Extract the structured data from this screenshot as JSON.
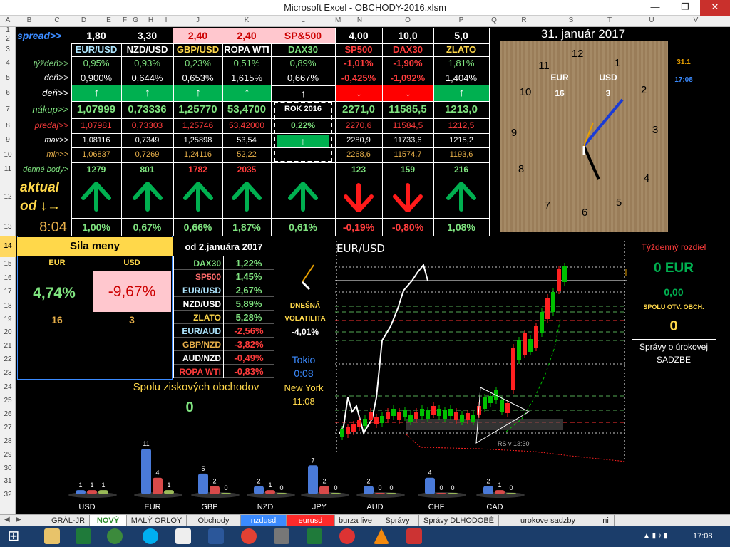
{
  "window": {
    "title": "Microsoft Excel - OBCHODY-2016.xlsm",
    "min": "—",
    "max": "❐",
    "close": "✕"
  },
  "columns": [
    "A",
    "B",
    "C",
    "D",
    "E",
    "F",
    "G",
    "H",
    "I",
    "J",
    "K",
    "L",
    "M",
    "N",
    "O",
    "P",
    "Q",
    "R",
    "S",
    "T",
    "U",
    "V"
  ],
  "rows": [
    "1",
    "2",
    "3",
    "4",
    "5",
    "6",
    "7",
    "8",
    "9",
    "10",
    "11",
    "12",
    "13",
    "14",
    "15",
    "16",
    "17",
    "18",
    "19",
    "20",
    "21",
    "22",
    "23",
    "24",
    "25",
    "26",
    "27",
    "28",
    "29",
    "30",
    "31",
    "32"
  ],
  "selected_row": "14",
  "header": {
    "spread_label": "spread>>",
    "spreads": [
      "1,80",
      "3,30",
      "2,40",
      "2,40"
    ],
    "sp500_label": "SP&500",
    "spreads2": [
      "4,00",
      "10,0",
      "5,0"
    ],
    "date": "31. január 2017"
  },
  "instruments": [
    "EUR/USD",
    "NZD/USD",
    "GBP/USD",
    "ROPA WTI",
    "DAX30",
    "SP500",
    "DAX30",
    "ZLATO"
  ],
  "rowlabels": {
    "week": "týždeň>>",
    "day": "deň>>",
    "day2": "deň>>",
    "buy": "nákup>>",
    "sell": "predaj>>",
    "max": "max>>",
    "min": "min>>",
    "points": "denné body>"
  },
  "week": [
    "0,95%",
    "0,93%",
    "0,23%",
    "0,51%",
    "0,89%",
    "-1,01%",
    "-1,90%",
    "1,81%"
  ],
  "day": [
    "0,900%",
    "0,644%",
    "0,653%",
    "1,615%",
    "0,667%",
    "-0,425%",
    "-1,092%",
    "1,404%"
  ],
  "arrow_up": "↑",
  "arrow_down": "↓",
  "buy": [
    "1,07999",
    "0,73336",
    "1,25770",
    "53,4700",
    "2271,0",
    "11585,5",
    "1213,0"
  ],
  "rok": "ROK 2016",
  "rok_val": "0,22%",
  "sell": [
    "1,07981",
    "0,73303",
    "1,25746",
    "53,42000",
    "2270,6",
    "11584,5",
    "1212,5"
  ],
  "max": [
    "1,08116",
    "0,7349",
    "1,25898",
    "53,54",
    "2280,9",
    "11733,6",
    "1215,2"
  ],
  "min": [
    "1,06837",
    "0,7269",
    "1,24116",
    "52,22",
    "2268,6",
    "11574,7",
    "1193,6"
  ],
  "points": [
    "1279",
    "801",
    "1782",
    "2035",
    "123",
    "159",
    "216"
  ],
  "actual_label": "aktual",
  "od_label": "od ↓→",
  "time": "8:04",
  "actual_pct": [
    "1,00%",
    "0,67%",
    "0,66%",
    "1,87%",
    "0,61%",
    "-0,19%",
    "-0,80%",
    "1,08%"
  ],
  "clock": {
    "numbers": [
      "12",
      "1",
      "2",
      "3",
      "4",
      "5",
      "6",
      "7",
      "8",
      "9",
      "10",
      "11"
    ],
    "eur": "EUR",
    "usd": "USD",
    "eur_v": "16",
    "usd_v": "3",
    "side1": "31.1",
    "side2": "17:08"
  },
  "strength": {
    "title": "Sila meny",
    "c1": "EUR",
    "c2": "USD",
    "v1": "4,74%",
    "v2": "-9,67%",
    "n1": "16",
    "n2": "3"
  },
  "perf": {
    "title": "od 2.januára 2017",
    "names": [
      "DAX30",
      "SP500",
      "EUR/USD",
      "NZD/USD",
      "ZLATO",
      "EUR/AUD",
      "GBP/NZD",
      "AUD/NZD",
      "ROPA WTI"
    ],
    "values": [
      "1,22%",
      "1,45%",
      "2,67%",
      "5,89%",
      "5,28%",
      "-2,56%",
      "-3,82%",
      "-0,49%",
      "-0,83%"
    ]
  },
  "vol": {
    "l1": "DNEŠNÁ",
    "l2": "VOLATILITA",
    "v": "-4,01%",
    "tokio": "Tokio",
    "tokio_t": "0:08",
    "ny": "New York",
    "ny_t": "11:08"
  },
  "profits": {
    "label": "Spolu ziskových obchodov",
    "v": "0"
  },
  "chart": {
    "title": "EUR/USD",
    "rs": "RS v 13:30"
  },
  "right": {
    "week_diff": "Týždenný rozdiel",
    "eur": "0 EUR",
    "zero": "0,00",
    "open": "SPOLU OTV. OBCH.",
    "open_v": "0",
    "news": "Správy o úrokovej",
    "rates": "SADZBE"
  },
  "currency_chart": {
    "type": "bar",
    "categories": [
      "USD",
      "EUR",
      "GBP",
      "NZD",
      "JPY",
      "AUD",
      "CHF",
      "CAD"
    ],
    "series": [
      {
        "values": [
          1,
          11,
          5,
          2,
          7,
          2,
          4,
          2
        ]
      },
      {
        "values": [
          1,
          4,
          2,
          1,
          2,
          0,
          0,
          1
        ]
      },
      {
        "values": [
          1,
          1,
          0,
          0,
          0,
          0,
          0,
          0
        ]
      }
    ]
  },
  "sheet_tabs": [
    "GRÁL-JR",
    "NOVÝ",
    "MALÝ ORLOY",
    "Obchody",
    "nzdusd",
    "eurusd",
    "burza live",
    "Správy",
    "Správy DLHODOBÉ",
    "urokove sadzby",
    "ni"
  ],
  "taskbar": {
    "clock": "17:08"
  }
}
